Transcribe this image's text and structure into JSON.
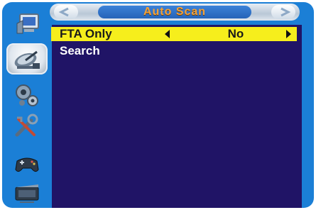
{
  "header": {
    "title": "Auto Scan"
  },
  "menu": [
    {
      "label": "FTA Only",
      "value": "No",
      "selected": true
    },
    {
      "label": "Search",
      "value": "",
      "selected": false
    }
  ],
  "sidebar": {
    "items": [
      {
        "icon": "tv-installation-icon"
      },
      {
        "icon": "satellite-dish-icon"
      },
      {
        "icon": "settings-gears-icon"
      },
      {
        "icon": "tools-icon"
      },
      {
        "icon": "gamepad-icon"
      },
      {
        "icon": "media-player-icon"
      }
    ],
    "active_index": 1
  },
  "colors": {
    "frame": "#1b7fd6",
    "panel": "#201466",
    "highlight": "#f6ee1c",
    "title_text": "#f2a13a"
  }
}
